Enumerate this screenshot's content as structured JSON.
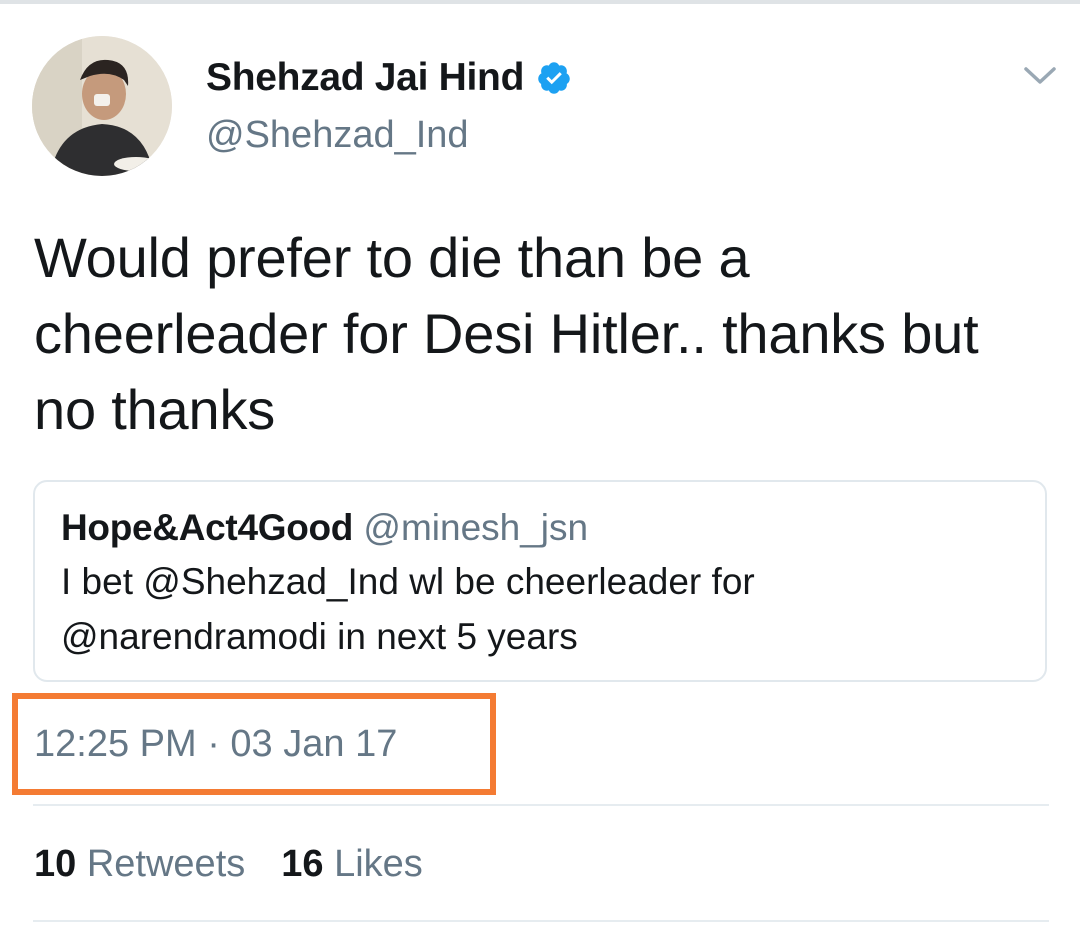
{
  "tweet": {
    "display_name": "Shehzad Jai Hind",
    "handle": "@Shehzad_Ind",
    "text": "Would prefer to die than be a cheerleader for Desi Hitler.. thanks but no thanks",
    "timestamp": "12:25 PM · 03 Jan 17",
    "verified": true
  },
  "quoted_tweet": {
    "display_name": "Hope&Act4Good",
    "handle": "@minesh_jsn",
    "text": "I bet @Shehzad_Ind wl be cheerleader for @narendramodi in next 5 years"
  },
  "stats": {
    "retweets_count": "10",
    "retweets_label": "Retweets",
    "likes_count": "16",
    "likes_label": "Likes"
  },
  "icons": {
    "verified": "verified-badge-icon",
    "more": "chevron-down-icon"
  },
  "colors": {
    "verified_blue": "#1da1f2",
    "highlight_orange": "#f47b33",
    "secondary_text": "#657786"
  }
}
